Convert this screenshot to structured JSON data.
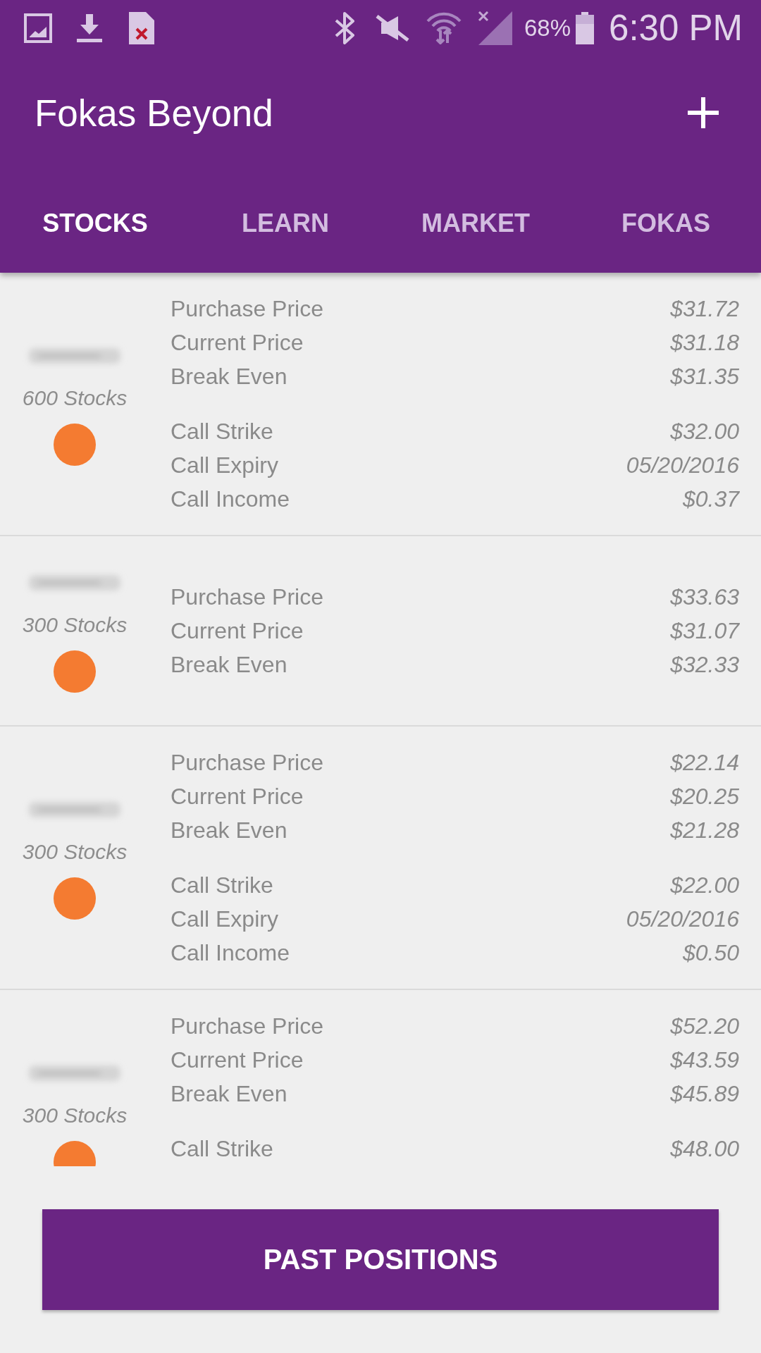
{
  "status_bar": {
    "battery": "68%",
    "time": "6:30 PM"
  },
  "app_bar": {
    "title": "Fokas Beyond"
  },
  "tabs": [
    {
      "label": "STOCKS",
      "selected": true
    },
    {
      "label": "LEARN",
      "selected": false
    },
    {
      "label": "MARKET",
      "selected": false
    },
    {
      "label": "FOKAS",
      "selected": false
    }
  ],
  "positions": [
    {
      "quantity": "600 Stocks",
      "color": "#f47b31",
      "details": [
        {
          "label": "Purchase Price",
          "value": "$31.72"
        },
        {
          "label": "Current Price",
          "value": "$31.18"
        },
        {
          "label": "Break Even",
          "value": "$31.35"
        }
      ],
      "call_details": [
        {
          "label": "Call Strike",
          "value": "$32.00"
        },
        {
          "label": "Call Expiry",
          "value": "05/20/2016"
        },
        {
          "label": "Call Income",
          "value": "$0.37"
        }
      ]
    },
    {
      "quantity": "300 Stocks",
      "color": "#f47b31",
      "details": [
        {
          "label": "Purchase Price",
          "value": "$33.63"
        },
        {
          "label": "Current Price",
          "value": "$31.07"
        },
        {
          "label": "Break Even",
          "value": "$32.33"
        }
      ]
    },
    {
      "quantity": "300 Stocks",
      "color": "#f47b31",
      "details": [
        {
          "label": "Purchase Price",
          "value": "$22.14"
        },
        {
          "label": "Current Price",
          "value": "$20.25"
        },
        {
          "label": "Break Even",
          "value": "$21.28"
        }
      ],
      "call_details": [
        {
          "label": "Call Strike",
          "value": "$22.00"
        },
        {
          "label": "Call Expiry",
          "value": "05/20/2016"
        },
        {
          "label": "Call Income",
          "value": "$0.50"
        }
      ]
    },
    {
      "quantity": "300 Stocks",
      "color": "#f47b31",
      "details": [
        {
          "label": "Purchase Price",
          "value": "$52.20"
        },
        {
          "label": "Current Price",
          "value": "$43.59"
        },
        {
          "label": "Break Even",
          "value": "$45.89"
        }
      ],
      "call_details": [
        {
          "label": "Call Strike",
          "value": "$48.00"
        }
      ]
    }
  ],
  "past_positions_button": {
    "label": "PAST POSITIONS"
  }
}
